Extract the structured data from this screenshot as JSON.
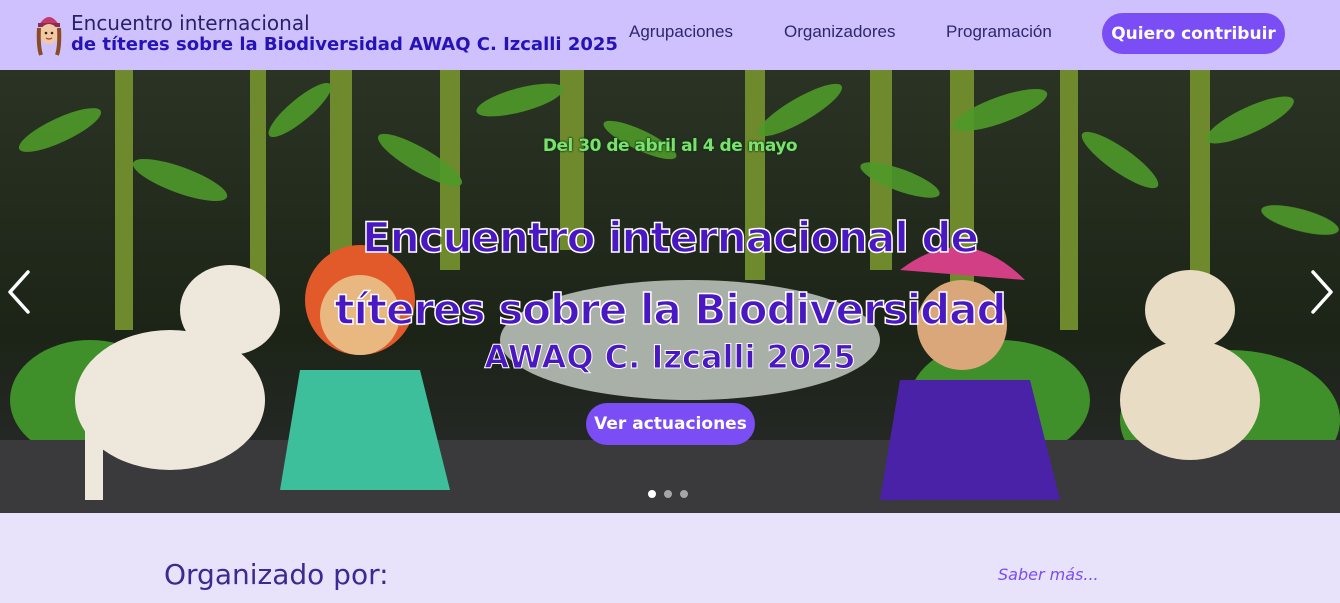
{
  "header": {
    "title_line1": "Encuentro internacional",
    "title_line2": "de títeres sobre la Biodiversidad AWAQ C. Izcalli 2025",
    "nav": [
      {
        "label": "Agrupaciones"
      },
      {
        "label": "Organizadores"
      },
      {
        "label": "Programación"
      }
    ],
    "cta_label": "Quiero contribuir",
    "logo_icon": "puppet-girl-icon"
  },
  "hero": {
    "dates": "Del 30 de abril al 4 de mayo",
    "headline_line1": "Encuentro internacional de",
    "headline_line2": "títeres sobre la Biodiversidad",
    "subheadline": "AWAQ C. Izcalli 2025",
    "button_label": "Ver actuaciones",
    "prev_icon": "chevron-left-icon",
    "next_icon": "chevron-right-icon",
    "slides_count": 3,
    "active_slide": 1
  },
  "organizers": {
    "title": "Organizado por:",
    "more_link": "Saber más..."
  },
  "colors": {
    "header_bg": "#cfc1fd",
    "accent": "#7b4df4",
    "headline": "#4a18c2",
    "page_bg": "#e8e2fb"
  }
}
